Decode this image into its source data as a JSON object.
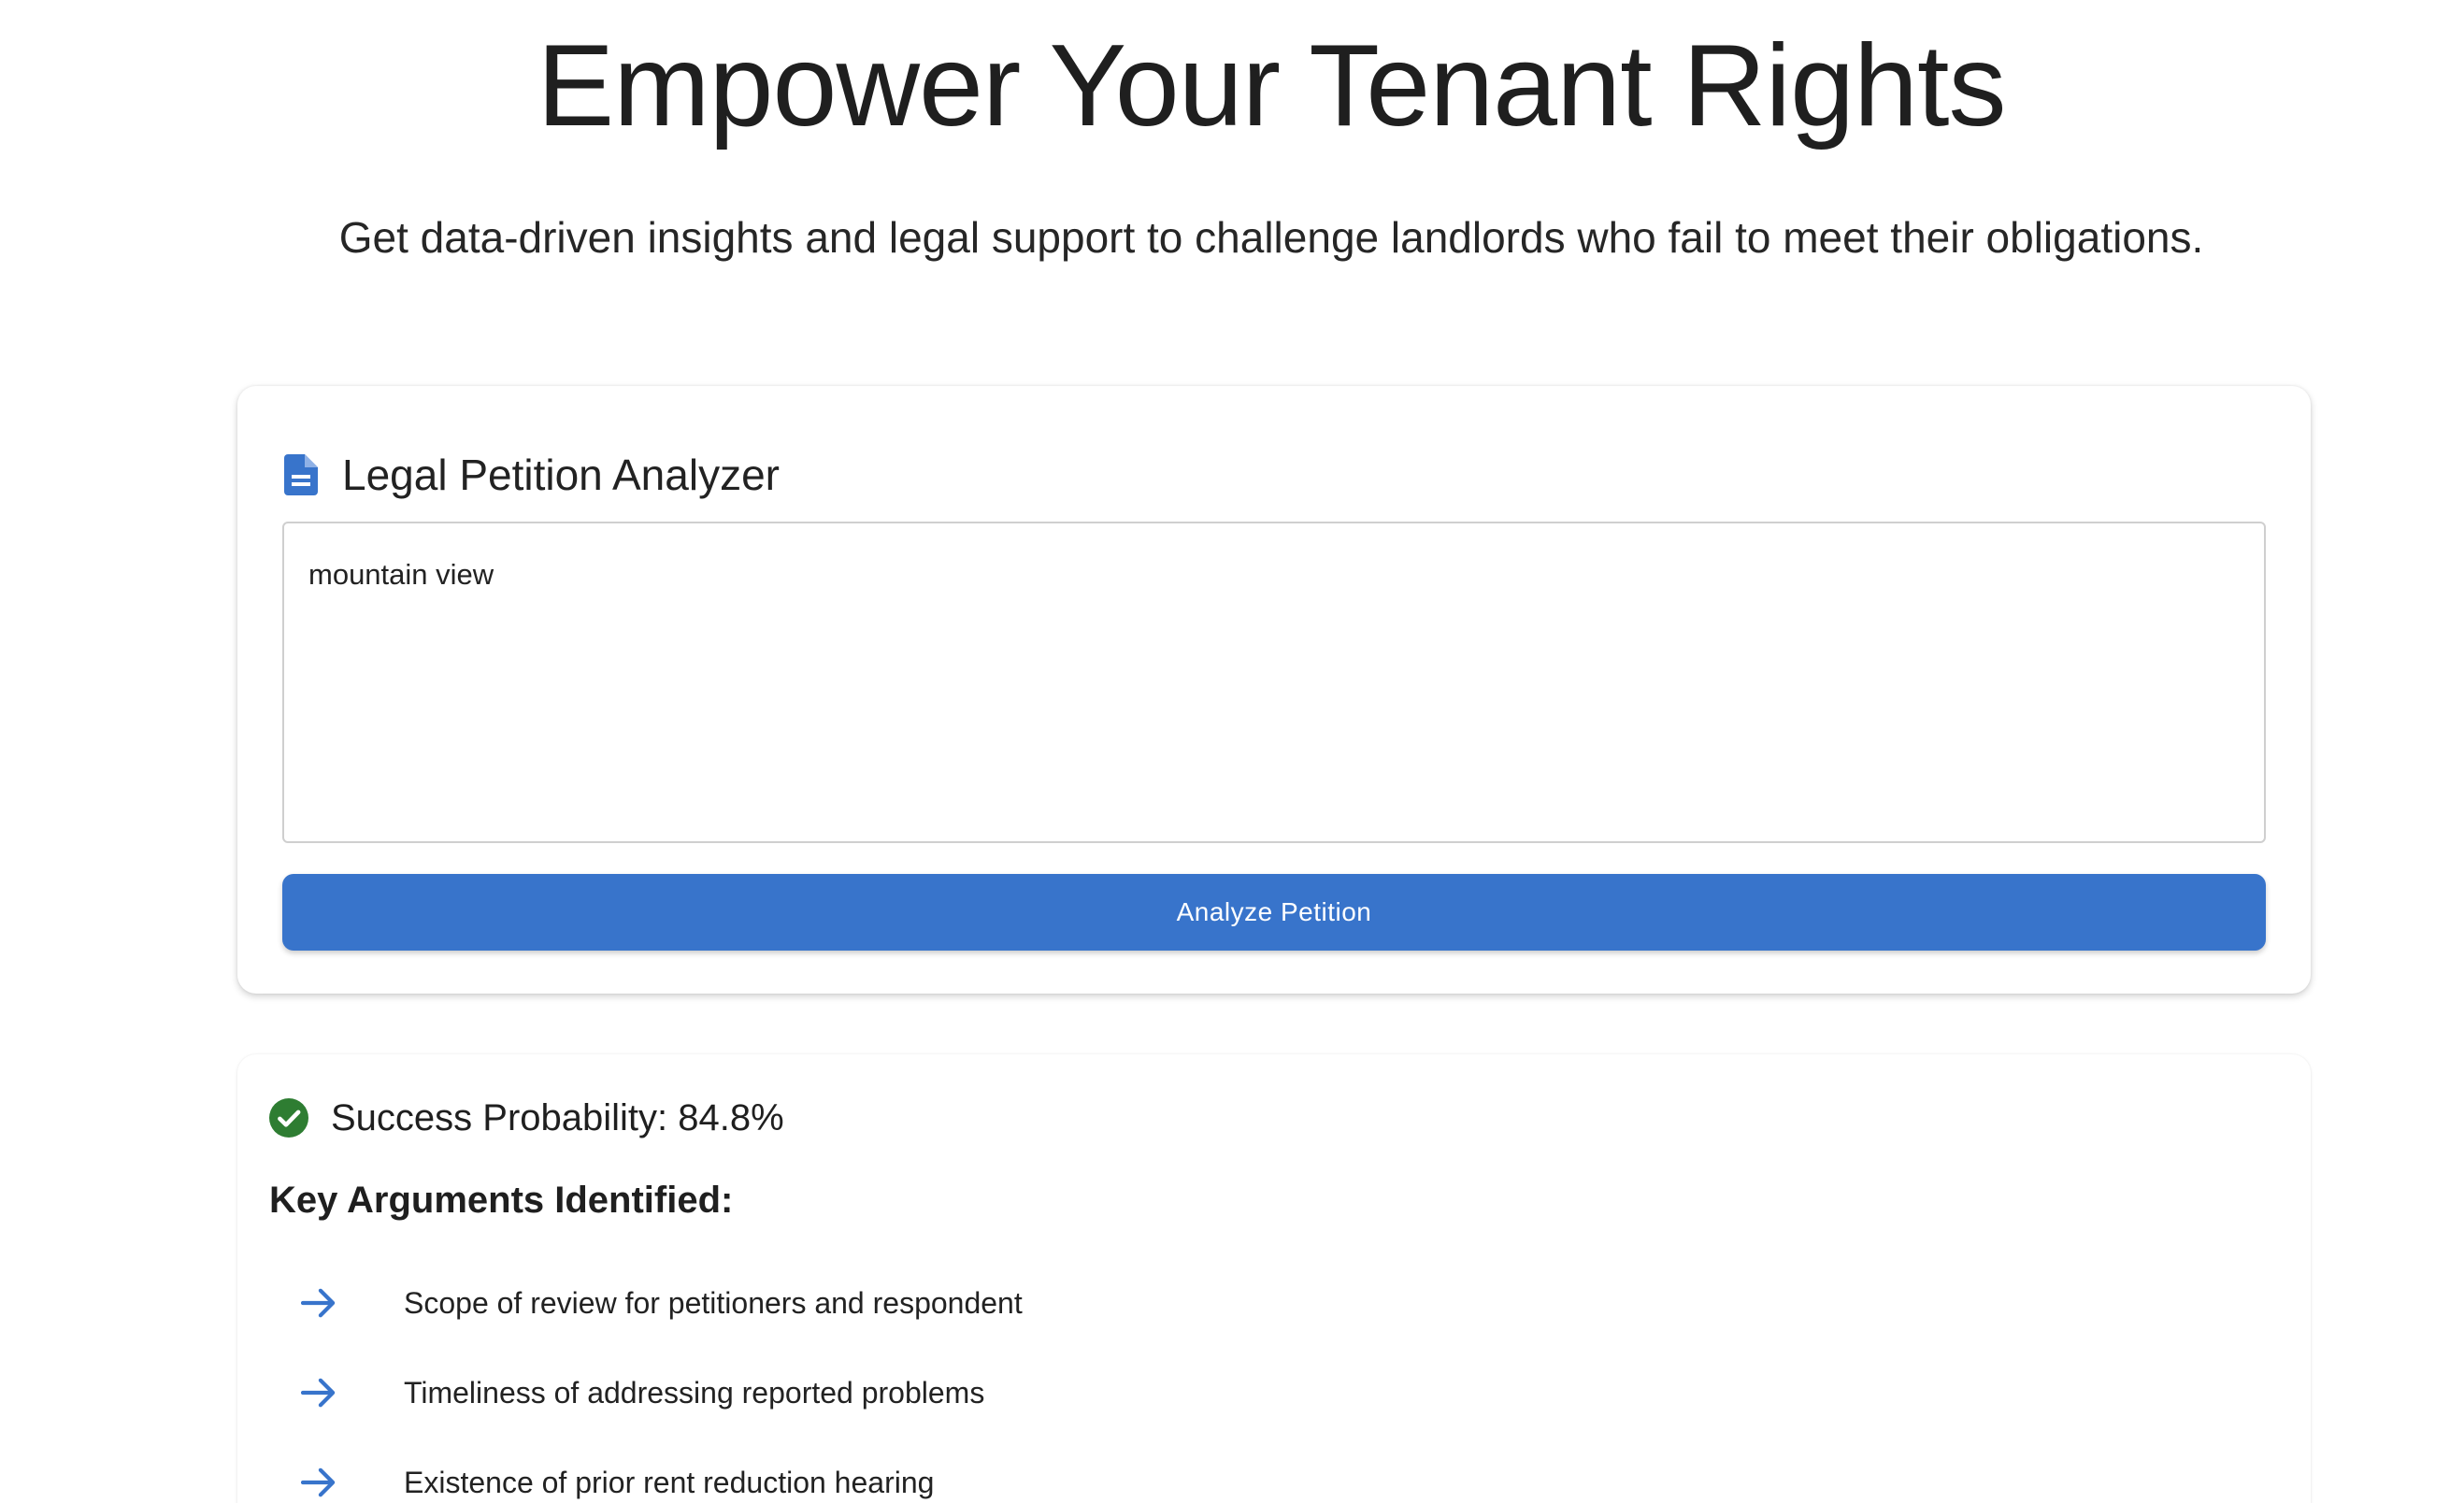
{
  "hero": {
    "title": "Empower Your Tenant Rights",
    "subtitle": "Get data-driven insights and legal support to challenge landlords who fail to meet their obligations."
  },
  "analyzer": {
    "icon": "document-icon",
    "title": "Legal Petition Analyzer",
    "input_value": "mountain view",
    "button_label": "Analyze Petition"
  },
  "results": {
    "status_icon": "check-circle-icon",
    "probability_text": "Success Probability: 84.8%",
    "arguments_heading": "Key Arguments Identified:",
    "arguments": [
      {
        "icon": "arrow-right-icon",
        "text": "Scope of review for petitioners and respondent"
      },
      {
        "icon": "arrow-right-icon",
        "text": "Timeliness of addressing reported problems"
      },
      {
        "icon": "arrow-right-icon",
        "text": "Existence of prior rent reduction hearing"
      }
    ]
  },
  "colors": {
    "primary": "#3874cb",
    "success": "#2e7d32",
    "text": "#1f1f1f"
  }
}
